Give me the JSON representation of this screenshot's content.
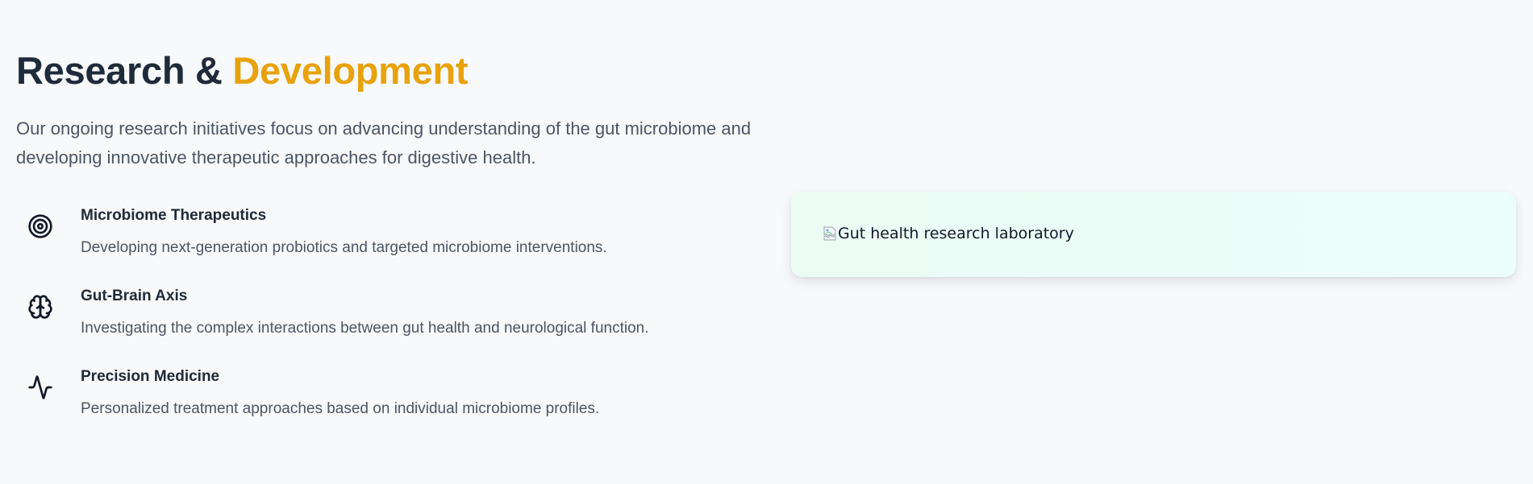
{
  "section": {
    "title_main": "Research & ",
    "title_accent": "Development",
    "intro": "Our ongoing research initiatives focus on advancing understanding of the gut microbiome and developing innovative therapeutic approaches for digestive health."
  },
  "features": [
    {
      "icon": "target-icon",
      "title": "Microbiome Therapeutics",
      "description": "Developing next-generation probiotics and targeted microbiome interventions."
    },
    {
      "icon": "brain-icon",
      "title": "Gut-Brain Axis",
      "description": "Investigating the complex interactions between gut health and neurological function."
    },
    {
      "icon": "activity-icon",
      "title": "Precision Medicine",
      "description": "Personalized treatment approaches based on individual microbiome profiles."
    }
  ],
  "image_card": {
    "alt_text": "Gut health research laboratory"
  },
  "colors": {
    "accent": "#e8a20c",
    "heading": "#1f2a3a",
    "body_text": "#4b5563",
    "page_background": "#f8f9fb",
    "card_background": "#ecfdf5"
  }
}
